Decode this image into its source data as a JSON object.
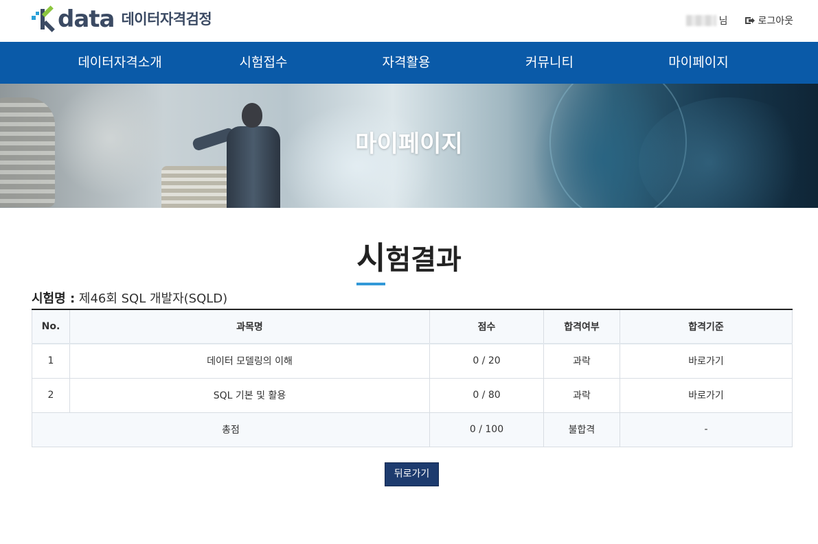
{
  "header": {
    "logo_text": "data",
    "logo_sub": "데이터자격검정",
    "user_suffix": "님",
    "logout_label": "로그아웃"
  },
  "nav": {
    "items": [
      {
        "label": "데이터자격소개"
      },
      {
        "label": "시험접수"
      },
      {
        "label": "자격활용"
      },
      {
        "label": "커뮤니티"
      },
      {
        "label": "마이페이지"
      }
    ]
  },
  "hero": {
    "title": "마이페이지"
  },
  "main": {
    "title_first": "시",
    "title_rest": "험결과",
    "exam_label": "시험명 :",
    "exam_name": "제46회 SQL 개발자(SQLD)",
    "table": {
      "headers": [
        "No.",
        "과목명",
        "점수",
        "합격여부",
        "합격기준"
      ],
      "rows": [
        {
          "no": "1",
          "subject": "데이터 모델링의 이해",
          "score": "0 / 20",
          "result": "과락",
          "criteria": "바로가기"
        },
        {
          "no": "2",
          "subject": "SQL 기본 및 활용",
          "score": "0 / 80",
          "result": "과락",
          "criteria": "바로가기"
        }
      ],
      "total": {
        "label": "총점",
        "score": "0 / 100",
        "result": "불합격",
        "criteria": "-"
      }
    },
    "back_label": "뒤로가기"
  }
}
